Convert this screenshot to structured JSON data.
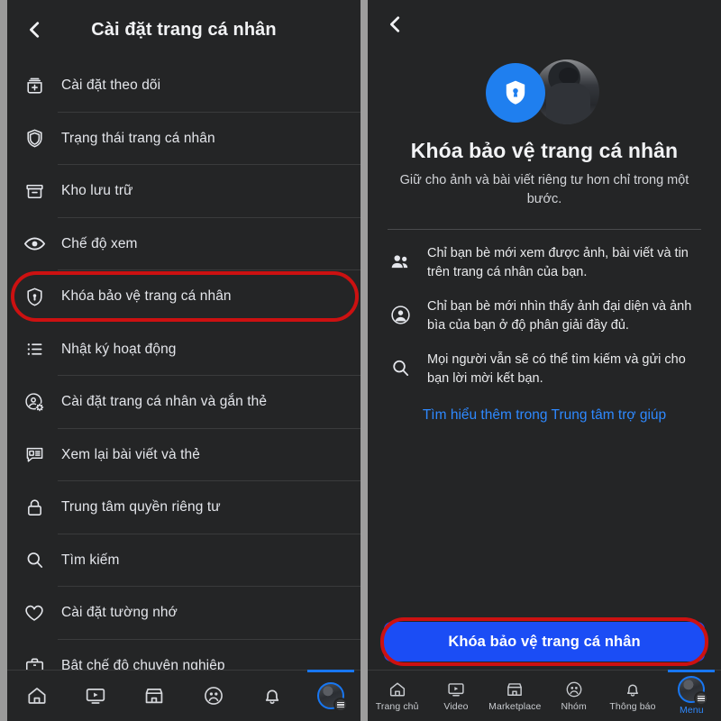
{
  "left_panel": {
    "header": {
      "back_icon": "chevron-left-icon",
      "title": "Cài đặt trang cá nhân"
    },
    "menu_items": [
      {
        "icon": "follow-settings-icon",
        "label": "Cài đặt theo dõi"
      },
      {
        "icon": "shield-icon",
        "label": "Trạng thái trang cá nhân"
      },
      {
        "icon": "archive-box-icon",
        "label": "Kho lưu trữ"
      },
      {
        "icon": "eye-icon",
        "label": "Chế độ xem"
      },
      {
        "icon": "shield-lock-icon",
        "label": "Khóa bảo vệ trang cá nhân",
        "highlighted": true
      },
      {
        "icon": "activity-log-icon",
        "label": "Nhật ký hoạt động"
      },
      {
        "icon": "profile-gear-icon",
        "label": "Cài đặt trang cá nhân và gắn thẻ"
      },
      {
        "icon": "post-review-icon",
        "label": "Xem lại bài viết và thẻ"
      },
      {
        "icon": "padlock-icon",
        "label": "Trung tâm quyền riêng tư"
      },
      {
        "icon": "search-icon",
        "label": "Tìm kiếm"
      },
      {
        "icon": "heart-icon",
        "label": "Cài đặt tường nhớ"
      },
      {
        "icon": "briefcase-icon",
        "label": "Bật chế độ chuyên nghiệp"
      }
    ]
  },
  "right_panel": {
    "header": {
      "back_icon": "chevron-left-icon"
    },
    "hero": {
      "shield_icon": "shield-keyhole-icon",
      "avatar": "profile-photo",
      "title": "Khóa bảo vệ trang cá nhân",
      "subtitle": "Giữ cho ảnh và bài viết riêng tư hơn chỉ trong một bước."
    },
    "features": [
      {
        "icon": "friends-icon",
        "text": "Chỉ bạn bè mới xem được ảnh, bài viết và tin trên trang cá nhân của bạn."
      },
      {
        "icon": "person-circle-icon",
        "text": "Chỉ bạn bè mới nhìn thấy ảnh đại diện và ảnh bìa của bạn ở độ phân giải đầy đủ."
      },
      {
        "icon": "search-icon",
        "text": "Mọi người vẫn sẽ có thể tìm kiếm và gửi cho bạn lời mời kết bạn."
      }
    ],
    "help_link": "Tìm hiểu thêm trong Trung tâm trợ giúp",
    "cta_label": "Khóa bảo vệ trang cá nhân"
  },
  "bottom_nav": {
    "items": [
      {
        "icon": "home-icon",
        "label": "Trang chủ",
        "active": false
      },
      {
        "icon": "video-icon",
        "label": "Video",
        "active": false
      },
      {
        "icon": "marketplace-icon",
        "label": "Marketplace",
        "active": false
      },
      {
        "icon": "groups-icon",
        "label": "Nhóm",
        "active": false
      },
      {
        "icon": "bell-icon",
        "label": "Thông báo",
        "active": false
      },
      {
        "icon": "menu-avatar-icon",
        "label": "Menu",
        "active": true
      }
    ]
  },
  "colors": {
    "background": "#242526",
    "accent_blue": "#1877f2",
    "cta_blue": "#1b4df5",
    "highlight_red": "#cc1111",
    "link_blue": "#2e89ff",
    "text_primary": "#e4e6eb",
    "divider": "#3a3b3c"
  }
}
